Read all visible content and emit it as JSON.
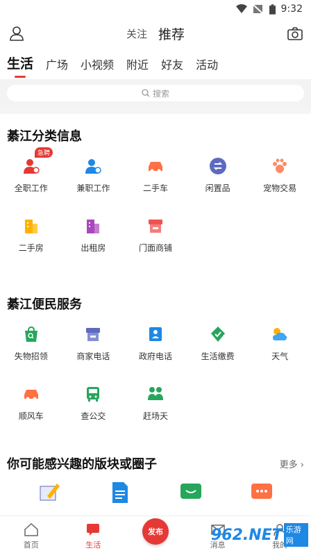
{
  "status": {
    "time": "9:32"
  },
  "header": {
    "follow_label": "关注",
    "recommend_label": "推荐"
  },
  "tabs": [
    "生活",
    "广场",
    "小视频",
    "附近",
    "好友",
    "活动"
  ],
  "search": {
    "placeholder": "搜索"
  },
  "classified": {
    "title": "綦江分类信息",
    "items": [
      {
        "label": "全职工作",
        "icon": "fulltime-job-icon",
        "color": "#e53935",
        "badge": "急聘"
      },
      {
        "label": "兼职工作",
        "icon": "parttime-job-icon",
        "color": "#1e88e5"
      },
      {
        "label": "二手车",
        "icon": "used-car-icon",
        "color": "#ff7043"
      },
      {
        "label": "闲置品",
        "icon": "idle-goods-icon",
        "color": "#5c6bc0"
      },
      {
        "label": "宠物交易",
        "icon": "pet-icon",
        "color": "#ff8a65"
      },
      {
        "label": "二手房",
        "icon": "used-house-icon",
        "color": "#ffb300"
      },
      {
        "label": "出租房",
        "icon": "rental-icon",
        "color": "#ab47bc"
      },
      {
        "label": "门面商铺",
        "icon": "shop-front-icon",
        "color": "#ef5350"
      }
    ]
  },
  "services": {
    "title": "綦江便民服务",
    "items": [
      {
        "label": "失物招领",
        "icon": "lost-found-icon",
        "color": "#26a65b"
      },
      {
        "label": "商家电话",
        "icon": "merchant-phone-icon",
        "color": "#5c6bc0"
      },
      {
        "label": "政府电话",
        "icon": "gov-phone-icon",
        "color": "#1e88e5"
      },
      {
        "label": "生活缴费",
        "icon": "bill-pay-icon",
        "color": "#26a65b"
      },
      {
        "label": "天气",
        "icon": "weather-icon",
        "color": "#42a5f5"
      },
      {
        "label": "顺风车",
        "icon": "carpool-icon",
        "color": "#ff7043"
      },
      {
        "label": "查公交",
        "icon": "bus-icon",
        "color": "#26a65b"
      },
      {
        "label": "赶场天",
        "icon": "market-day-icon",
        "color": "#26a65b"
      }
    ]
  },
  "interest": {
    "title": "你可能感兴趣的版块或圈子",
    "more_label": "更多"
  },
  "bottom_nav": {
    "home": "首页",
    "life": "生活",
    "publish": "发布",
    "message": "消息",
    "mine": "我的"
  },
  "watermark": {
    "site": "962.NET",
    "tag": "乐游网"
  },
  "colors": {
    "accent": "#e53935"
  }
}
